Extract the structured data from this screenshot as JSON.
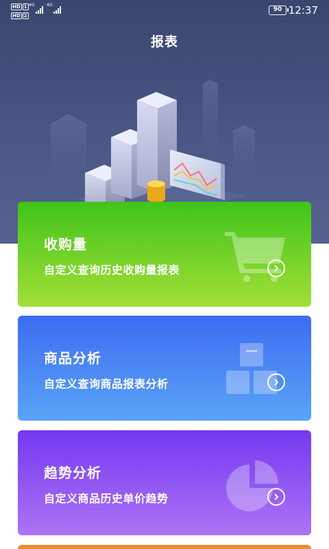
{
  "status_bar": {
    "sim1_badge": "HD",
    "sim1_slot": "1",
    "sim2_badge": "HD",
    "sim2_slot": "2",
    "network1": "4G",
    "network2": "4G",
    "battery": "90",
    "time": "12:37"
  },
  "header": {
    "title": "报表"
  },
  "cards": [
    {
      "title": "收购量",
      "description": "自定义查询历史收购量报表",
      "icon": "cart-icon",
      "color_top": "#40c41a",
      "color_bottom": "#a3df38"
    },
    {
      "title": "商品分析",
      "description": "自定义查询商品报表分析",
      "icon": "boxes-icon",
      "color_top": "#3d6cf2",
      "color_bottom": "#5aa4f6"
    },
    {
      "title": "趋势分析",
      "description": "自定义商品历史单价趋势",
      "icon": "pie-chart-icon",
      "color_top": "#7339f0",
      "color_bottom": "#ad73f5"
    }
  ],
  "partial_card_color": "#f08a2e",
  "header_color": "#3a466e"
}
